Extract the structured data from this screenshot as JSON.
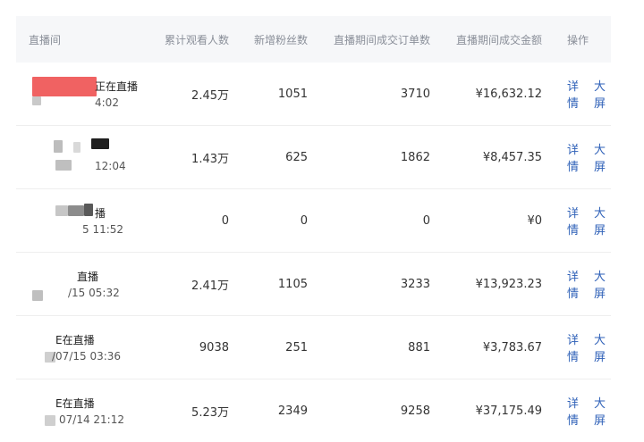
{
  "columns": [
    "直播间",
    "累计观看人数",
    "新增粉丝数",
    "直播期间成交订单数",
    "直播期间成交金额",
    "操作"
  ],
  "actions": {
    "detail": "详情",
    "bigscreen": "大屏"
  },
  "rows": [
    {
      "status": "正在直播",
      "time": "4:02",
      "views": "2.45万",
      "fans": "1051",
      "orders": "3710",
      "amount": "¥16,632.12"
    },
    {
      "status": "",
      "time": "12:04",
      "views": "1.43万",
      "fans": "625",
      "orders": "1862",
      "amount": "¥8,457.35"
    },
    {
      "status": "播",
      "time": "5 11:52",
      "views": "0",
      "fans": "0",
      "orders": "0",
      "amount": "¥0"
    },
    {
      "status": "直播",
      "time": "/15 05:32",
      "views": "2.41万",
      "fans": "1105",
      "orders": "3233",
      "amount": "¥13,923.23"
    },
    {
      "status": "E在直播",
      "time": "/07/15 03:36",
      "views": "9038",
      "fans": "251",
      "orders": "881",
      "amount": "¥3,783.67"
    },
    {
      "status": "E在直播",
      "time": "07/14 21:12",
      "views": "5.23万",
      "fans": "2349",
      "orders": "9258",
      "amount": "¥37,175.49"
    }
  ]
}
